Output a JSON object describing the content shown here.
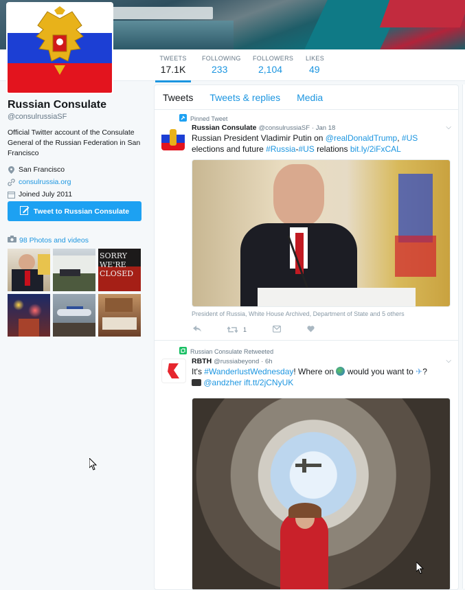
{
  "colors": {
    "accent": "#1da1f2",
    "link": "#1b95e0",
    "muted": "#657786"
  },
  "profile": {
    "name": "Russian Consulate",
    "handle": "@consulrussiaSF",
    "bio": "Official Twitter account of the Consulate General of the Russian Federation in San Francisco",
    "location": "San Francisco",
    "website": "consulrussia.org",
    "joined": "Joined July 2011",
    "tweet_to_label": "Tweet to Russian Consulate",
    "photos_label": "98 Photos and videos"
  },
  "stats": [
    {
      "label": "TWEETS",
      "value": "17.1K"
    },
    {
      "label": "FOLLOWING",
      "value": "233"
    },
    {
      "label": "FOLLOWERS",
      "value": "2,104"
    },
    {
      "label": "LIKES",
      "value": "49"
    }
  ],
  "tabs": [
    "Tweets",
    "Tweets & replies",
    "Media"
  ],
  "thumbnail_sign_text": "SORRY WE'RE CLOSED",
  "tweets": [
    {
      "context": "Pinned Tweet",
      "name": "Russian Consulate",
      "handle": "@consulrussiaSF",
      "time": "· Jan 18",
      "text_a": "Russian President Vladimir Putin on ",
      "link_a": "@realDonaldTrump",
      "text_b": ", ",
      "link_b": "#US",
      "text_c": "elections and future ",
      "link_c": "#Russia",
      "text_d": "-",
      "link_d": "#US",
      "text_e": " relations ",
      "link_e": "bit.ly/2iFxCAL",
      "tagged": "President of Russia, White House Archived, Department of State and 5 others",
      "retweets": "1"
    },
    {
      "context": "Russian Consulate Retweeted",
      "name": "RBTH",
      "handle": "@russiabeyond",
      "time": "· 6h",
      "text_a": "It's ",
      "link_a": "#WanderlustWednesday",
      "text_b": "! Where on ",
      "text_c": " would you want to ",
      "text_d": "?",
      "link_b": "@andzher",
      "link_c": "ift.tt/2jCNyUK"
    }
  ]
}
